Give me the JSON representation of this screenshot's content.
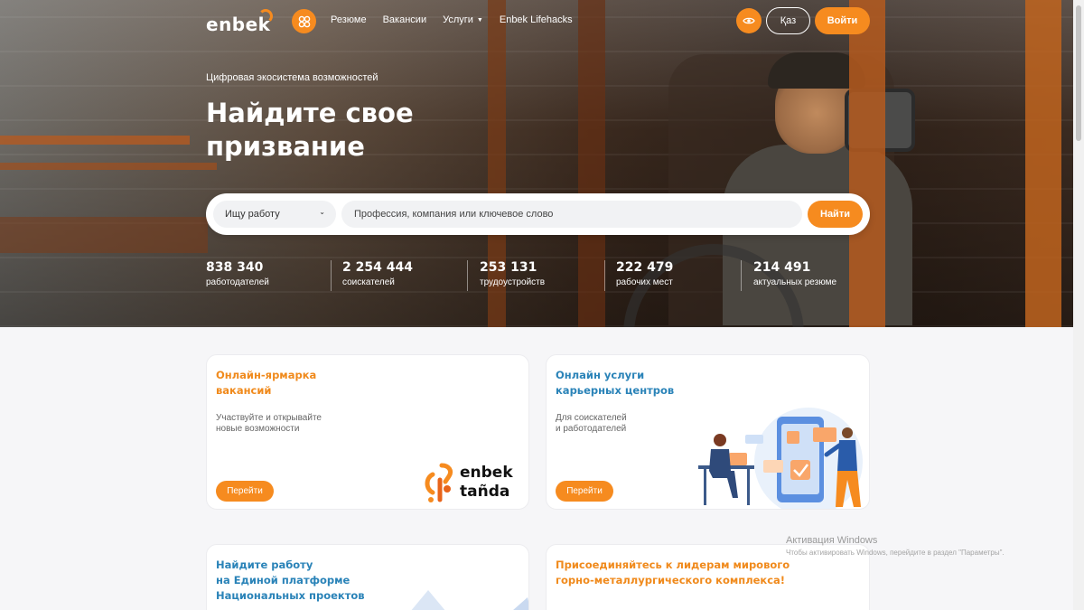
{
  "brand": {
    "logo_text": "enbek",
    "accent": "#f68b1f",
    "blue": "#2a83b8"
  },
  "nav": {
    "items": [
      {
        "label": "Резюме"
      },
      {
        "label": "Вакансии"
      },
      {
        "label": "Услуги",
        "dropdown": true
      },
      {
        "label": "Enbek Lifehacks"
      }
    ],
    "accessibility_icon": "eye-icon",
    "lang_label": "Қаз",
    "login_label": "Войти"
  },
  "hero": {
    "subtitle": "Цифровая экосистема возможностей",
    "title": "Найдите свое призвание"
  },
  "search": {
    "mode_label": "Ищу работу",
    "placeholder": "Профессия, компания или ключевое слово",
    "button_label": "Найти"
  },
  "stats": [
    {
      "value": "838 340",
      "label": "работодателей"
    },
    {
      "value": "2 254 444",
      "label": "соискателей"
    },
    {
      "value": "253 131",
      "label": "трудоустройств"
    },
    {
      "value": "222 479",
      "label": "рабочих мест"
    },
    {
      "value": "214 491",
      "label": "актуальных резюме"
    }
  ],
  "cards": [
    {
      "title_line1": "Онлайн-ярмарка",
      "title_line2": "вакансий",
      "desc_line1": "Участвуйте и открывайте",
      "desc_line2": "новые возможности",
      "button_label": "Перейти",
      "logo_line1": "enbek",
      "logo_line2": "tañda"
    },
    {
      "title_line1": "Онлайн услуги",
      "title_line2": "карьерных центров",
      "desc_line1": "Для соискателей",
      "desc_line2": "и работодателей",
      "button_label": "Перейти"
    },
    {
      "title_line1": "Найдите работу",
      "title_line2": "на Единой платформе",
      "title_line3": "Национальных проектов"
    },
    {
      "title_line1": "Присоединяйтесь к лидерам мирового",
      "title_line2": "горно-металлургического комплекса!"
    }
  ],
  "watermark": {
    "line1": "Активация Windows",
    "line2": "Чтобы активировать Windows, перейдите в раздел \"Параметры\"."
  }
}
